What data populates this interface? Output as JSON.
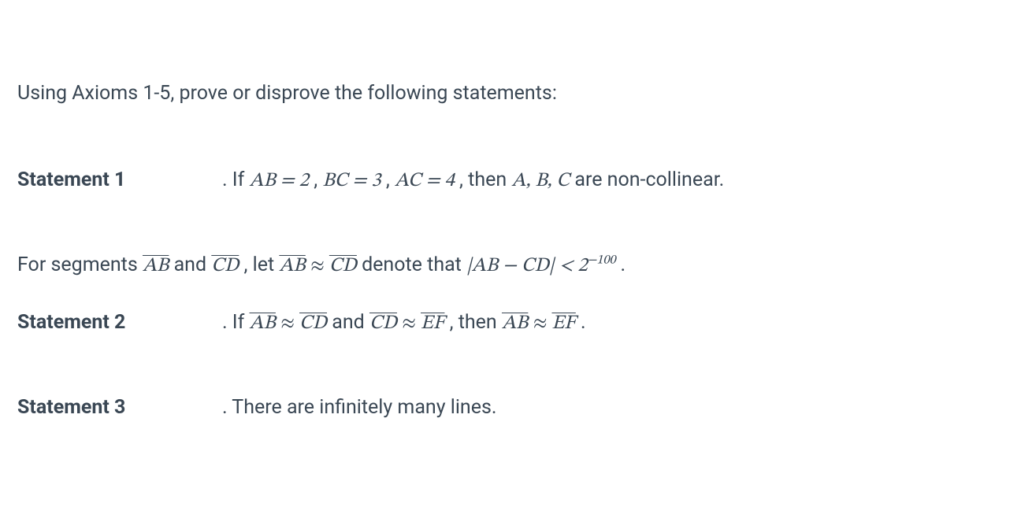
{
  "intro": "Using Axioms 1-5, prove or disprove the following statements:",
  "statements": {
    "s1": {
      "label": "Statement 1",
      "text_prefix": ". If ",
      "ab_eq": "AB = 2",
      "sep1": " , ",
      "bc_eq": "BC = 3",
      "sep2": " , ",
      "ac_eq": "AC = 4",
      "text_mid": ", then ",
      "abc": "A, B, C",
      "text_suffix": "  are non-collinear."
    },
    "defn": {
      "prefix": "For segments  ",
      "seg_ab": "AB",
      "and1": "  and  ",
      "seg_cd": "CD",
      "let": " , let ",
      "rel_ab": "AB",
      "approx1": " ≈ ",
      "rel_cd": "CD",
      "denote": "  denote that  ",
      "abs_expr": "|AB − CD| < 2",
      "exp": "−100",
      "tail": " ."
    },
    "s2": {
      "label": "Statement 2",
      "prefix": ". If ",
      "ab": "AB",
      "approx1": " ≈ ",
      "cd1": "CD",
      "and": "  and ",
      "cd2": "CD",
      "approx2": " ≈ ",
      "ef1": "EF",
      "then": " , then ",
      "ab2": "AB",
      "approx3": " ≈ ",
      "ef2": "EF",
      "tail": " ."
    },
    "s3": {
      "label": "Statement 3",
      "text": ".  There are infinitely many lines."
    }
  }
}
